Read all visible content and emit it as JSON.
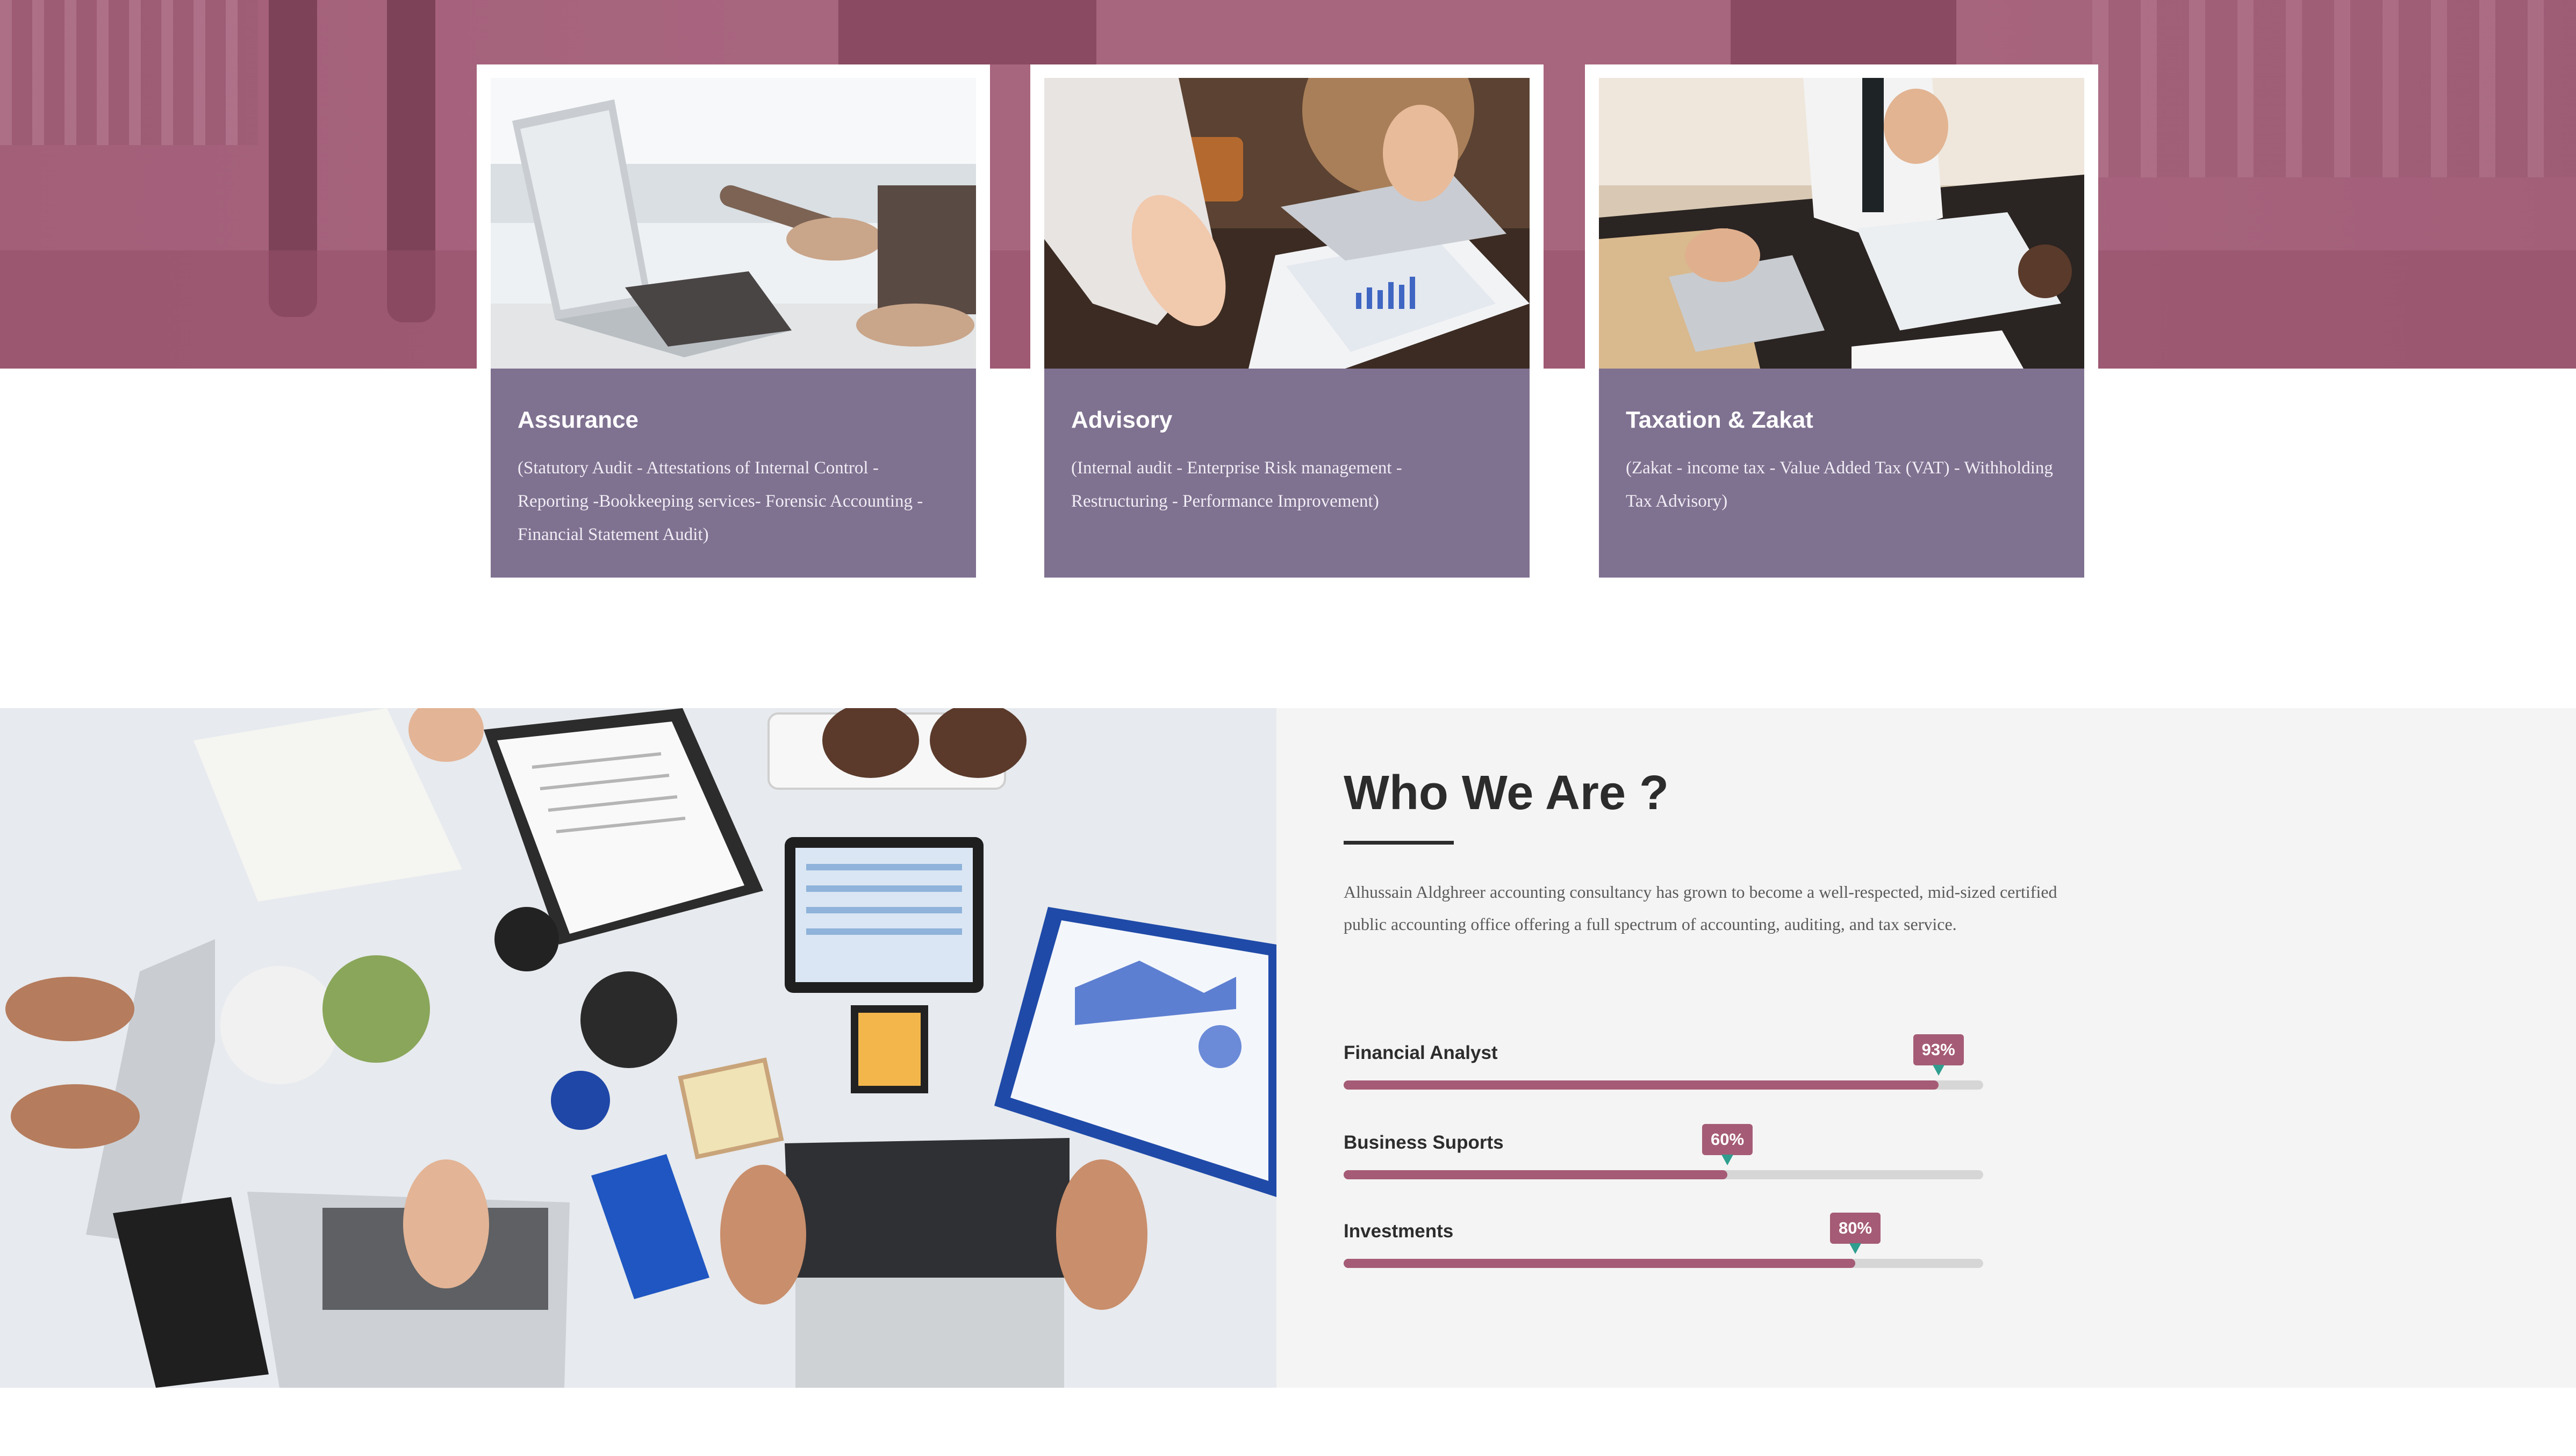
{
  "colors": {
    "hero_band": "#a8657e",
    "card_body": "#7f7190",
    "accent": "#a55b75",
    "marker": "#2f9e8f",
    "section_bg": "#f4f4f4"
  },
  "services": [
    {
      "title": "Assurance",
      "description": "(Statutory Audit - Attestations of Internal Control - Reporting -Bookkeeping services- Forensic Accounting - Financial Statement Audit)",
      "image": "laptop-calculator-photo"
    },
    {
      "title": "Advisory",
      "description": "(Internal audit - Enterprise Risk management - Restructuring - Performance Improvement)",
      "image": "chart-review-photo"
    },
    {
      "title": "Taxation & Zakat",
      "description": "(Zakat - income tax - Value Added Tax (VAT) - Withholding Tax Advisory)",
      "image": "desk-documents-photo"
    }
  ],
  "about": {
    "heading": "Who We Are ?",
    "intro": "Alhussain Aldghreer accounting consultancy has grown to become a well-respected, mid-sized certified public accounting office offering a full spectrum of accounting, auditing, and tax service.",
    "image": "team-desk-photo"
  },
  "skills": [
    {
      "label": "Financial Analyst",
      "percent": 93,
      "percent_label": "93%"
    },
    {
      "label": "Business Suports",
      "percent": 60,
      "percent_label": "60%"
    },
    {
      "label": "Investments",
      "percent": 80,
      "percent_label": "80%"
    }
  ]
}
